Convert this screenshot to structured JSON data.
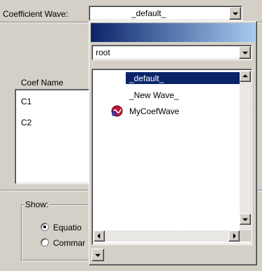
{
  "header": {
    "label": "Coefficient Wave:",
    "selected": "_default_"
  },
  "coef_panel": {
    "column_header": "Coef Name",
    "rows": [
      "C1",
      "C2"
    ]
  },
  "show_group": {
    "title": "Show:",
    "options": [
      {
        "label": "Equatio",
        "checked": true
      },
      {
        "label": "Commar",
        "checked": false
      }
    ]
  },
  "popup": {
    "folder_value": "root",
    "items": [
      {
        "label": "_default_",
        "selected": true,
        "icon": ""
      },
      {
        "label": "_New Wave_",
        "selected": false,
        "icon": ""
      },
      {
        "label": "MyCoefWave",
        "selected": false,
        "icon": "wave-file-icon"
      }
    ]
  },
  "colors": {
    "titlebar_start": "#0a246a",
    "titlebar_end": "#a6caf0",
    "selection": "#0a246a",
    "face": "#d4d0c8"
  }
}
